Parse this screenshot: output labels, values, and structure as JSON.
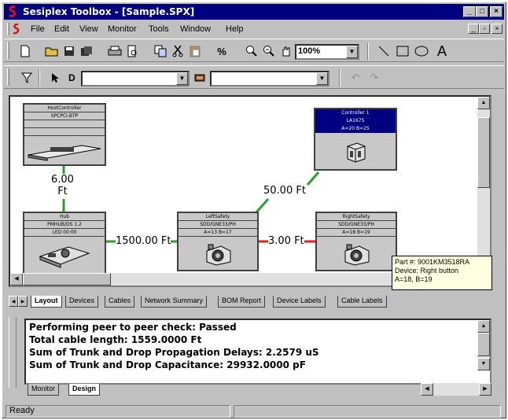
{
  "window": {
    "title": "Sesiplex Toolbox - [Sample.SPX]"
  },
  "menu": {
    "items": [
      {
        "label": "File"
      },
      {
        "label": "Edit"
      },
      {
        "label": "View"
      },
      {
        "label": "Monitor"
      },
      {
        "label": "Tools"
      },
      {
        "label": "Window"
      },
      {
        "label": "Help"
      }
    ]
  },
  "toolbar": {
    "zoom_value": "100%",
    "address_label": "D",
    "address_value": "",
    "device_value": ""
  },
  "devices": [
    {
      "id": "host",
      "rows": [
        "HostController",
        "SPCPCI.BTP",
        "",
        ""
      ]
    },
    {
      "id": "controller",
      "rows": [
        "Controller 1",
        "LA1675",
        "A=20 B=25"
      ]
    },
    {
      "id": "hub",
      "rows": [
        "Hub",
        "PMHUB/DS 1.2",
        "LED 00:00"
      ]
    },
    {
      "id": "tee",
      "rows": [
        "LeftSafety",
        "SDD/GNE33/PH",
        "A=13 B=17"
      ]
    },
    {
      "id": "right",
      "rows": [
        "RightSafety",
        "SDD/GNE33/PH",
        "A=18 B=19"
      ]
    }
  ],
  "cables": [
    {
      "label": "6.00\nFt"
    },
    {
      "label": "50.00 Ft"
    },
    {
      "label": "1500.00 Ft"
    },
    {
      "label": "3.00 Ft"
    }
  ],
  "tooltip": {
    "line1": "Part #: 9001KM3518RA",
    "line2": "Device: Right button",
    "line3": "A=18, B=19"
  },
  "doc_tabs": [
    {
      "label": "Layout",
      "active": true
    },
    {
      "label": "Devices"
    },
    {
      "label": "Cables"
    },
    {
      "label": "Network Summary"
    },
    {
      "label": "BOM Report"
    },
    {
      "label": "Device Labels"
    },
    {
      "label": "Cable Labels"
    }
  ],
  "output": {
    "lines": [
      "Performing peer to peer check: Passed",
      "Total cable length: 1559.0000 Ft",
      "Sum of Trunk and Drop Propagation Delays: 2.2579 uS",
      "Sum of Trunk and Drop Capacitance: 29932.0000 pF"
    ]
  },
  "output_tabs": [
    {
      "label": "Monitor"
    },
    {
      "label": "Design",
      "active": true
    }
  ],
  "status": {
    "text": "Ready"
  },
  "colors": {
    "titlebar": "#000080",
    "cable_green": "#2e9e2e",
    "cable_red": "#e02020",
    "tooltip_bg": "#ffffe1"
  }
}
